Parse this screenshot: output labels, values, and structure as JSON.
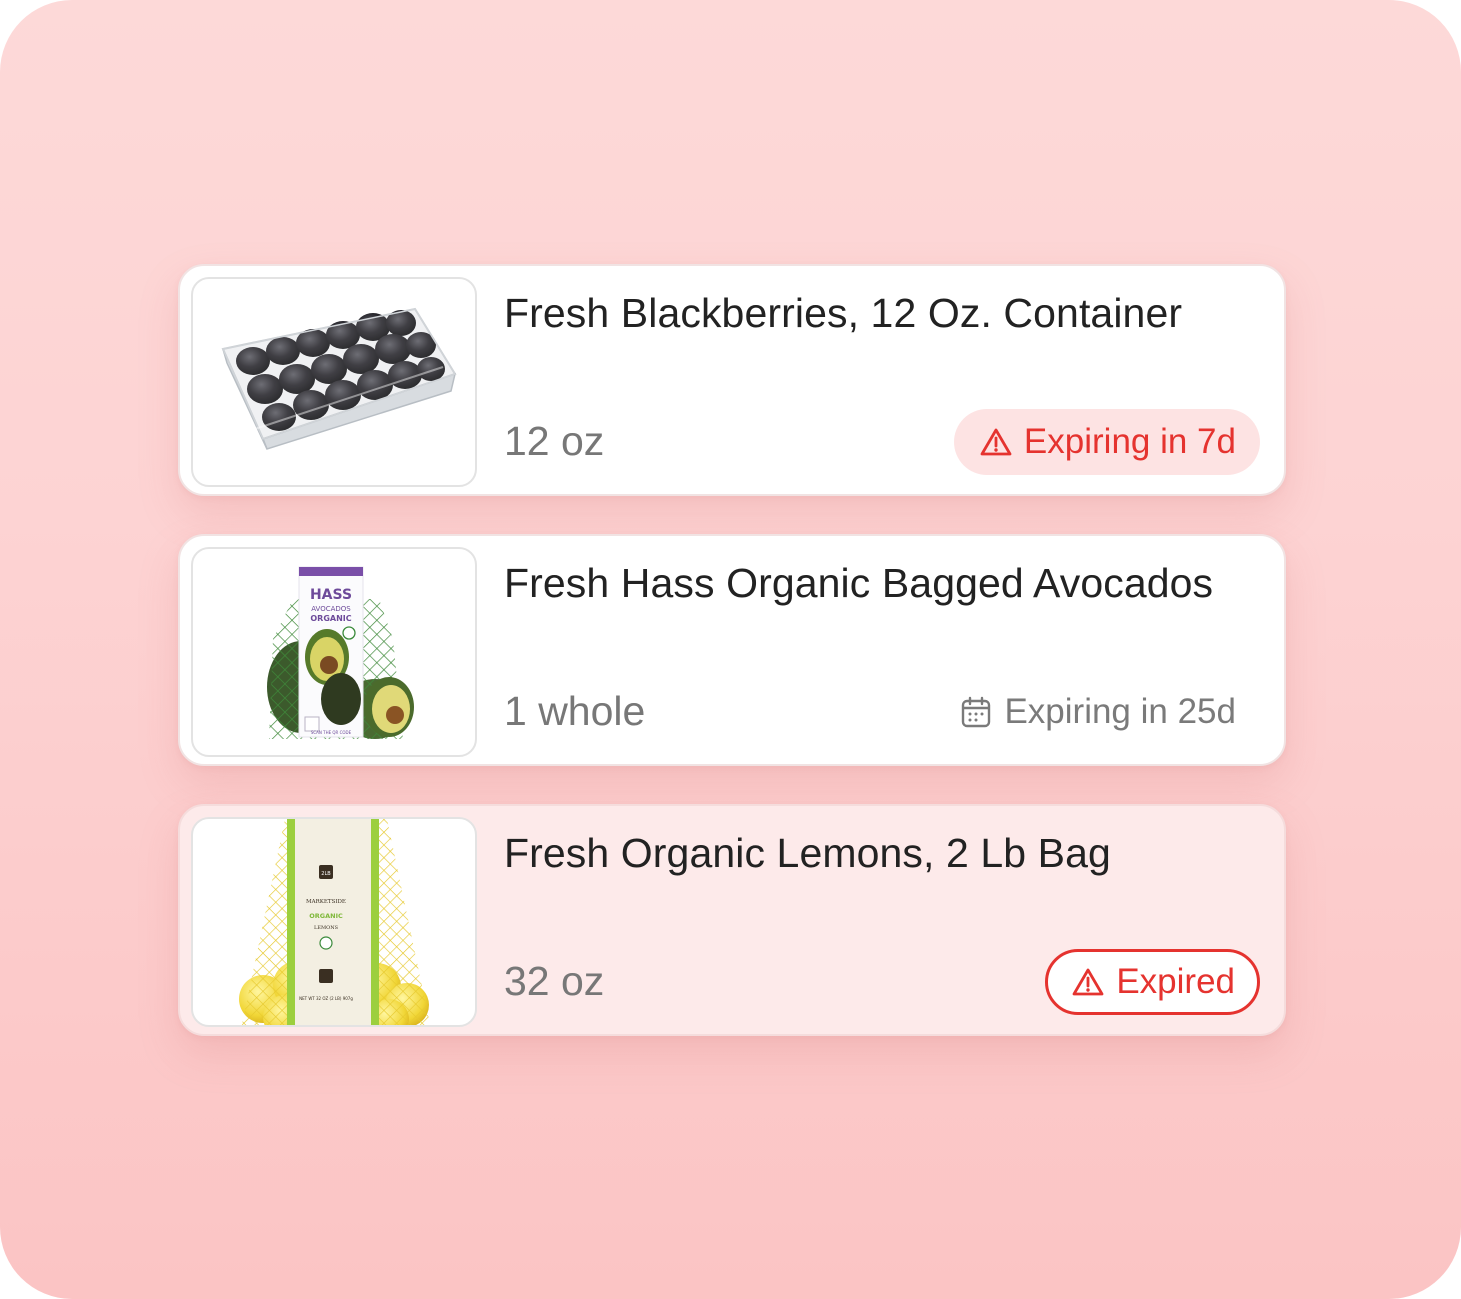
{
  "items": [
    {
      "title": "Fresh Blackberries, 12 Oz. Container",
      "quantity": "12 oz",
      "status": {
        "label": "Expiring in 7d",
        "icon": "warning-triangle-icon",
        "style": "warning",
        "color": "#e5332f"
      }
    },
    {
      "title": "Fresh Hass Organic Bagged Avocados",
      "quantity": "1 whole",
      "status": {
        "label": "Expiring in 25d",
        "icon": "calendar-icon",
        "style": "neutral",
        "color": "#7a7a7a"
      },
      "package_text": {
        "brand": "HASS",
        "line1": "AVOCADOS",
        "line2": "ORGANIC",
        "footer": "SCAN THE QR CODE"
      }
    },
    {
      "title": "Fresh Organic Lemons, 2 Lb Bag",
      "quantity": "32 oz",
      "status": {
        "label": "Expired",
        "icon": "warning-triangle-icon",
        "style": "expired",
        "color": "#e5332f"
      },
      "package_text": {
        "size": "2LB",
        "brand": "MARKETSIDE",
        "line1": "ORGANIC",
        "line2": "LEMONS",
        "net": "NET WT 32 OZ (2 LB) 907g"
      }
    }
  ]
}
